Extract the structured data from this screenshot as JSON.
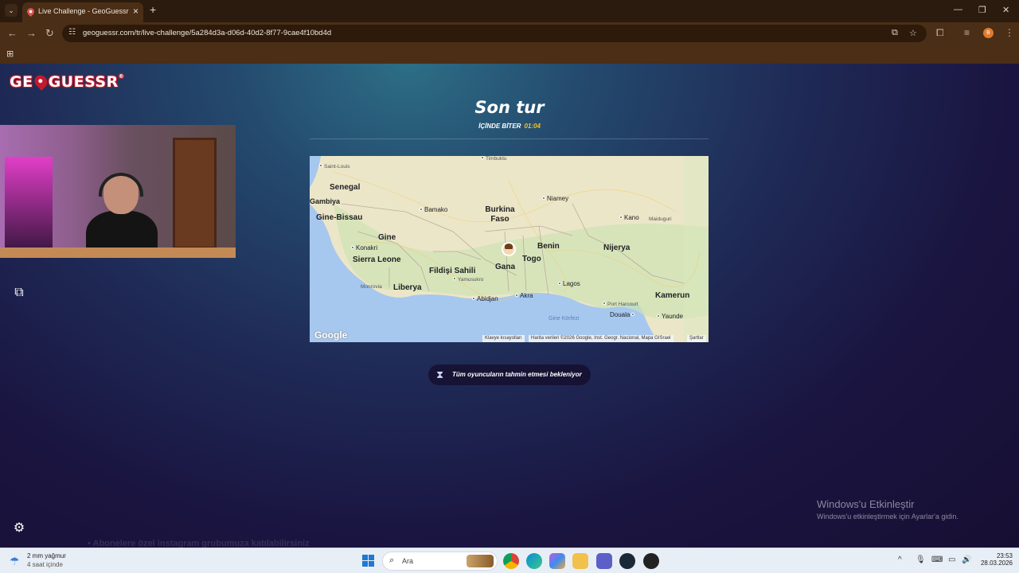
{
  "browser": {
    "tab_title": "Live Challenge - GeoGuessr",
    "url": "geoguessr.com/tr/live-challenge/5a284d3a-d06d-40d2-8f77-9cae4f10bd4d",
    "profile_initial": "B"
  },
  "page": {
    "logo_text_1": "GE",
    "logo_text_2": "GUESSR",
    "logo_reg": "®",
    "round_title": "Son tur",
    "timer_label": "İÇİNDE BİTER",
    "timer_value": "01:04",
    "waiting_text": "Tüm oyuncuların tahmin etmesi bekleniyor",
    "activate_title": "Windows'u Etkinleştir",
    "activate_sub": "Windows'u etkinleştirmek için Ayarlar'a gidin.",
    "promo_text": "• Abonelere özel instagram grubumuza katılabilirsiniz"
  },
  "map": {
    "countries": [
      "Senegal",
      "Gambiya",
      "Gine-Bissau",
      "Gine",
      "Sierra Leone",
      "Liberya",
      "Fildişi Sahili",
      "Burkina Faso",
      "Gana",
      "Togo",
      "Benin",
      "Nijerya",
      "Kamerun"
    ],
    "cities": [
      "Saint-Louis",
      "Timbuktu",
      "Niamey",
      "Bamako",
      "Kano",
      "Maiduguri",
      "Konakri",
      "Monrovia",
      "Yamusukro",
      "Abidjan",
      "Akra",
      "Lagos",
      "Port Harcourt",
      "Douala",
      "Yaunde"
    ],
    "water": "Gine Körfezi",
    "google": "Google",
    "attr_keyboard": "Klavye kısayolları",
    "attr_data": "Harita verileri ©2026 Google, Inst. Geogr. Nacional, Mapa GISrael",
    "attr_terms": "Şartlar"
  },
  "taskbar": {
    "weather_1": "2 mm yağmur",
    "weather_2": "4 saat içinde",
    "search_placeholder": "Ara",
    "time": "23:53",
    "date": "28.03.2026"
  }
}
